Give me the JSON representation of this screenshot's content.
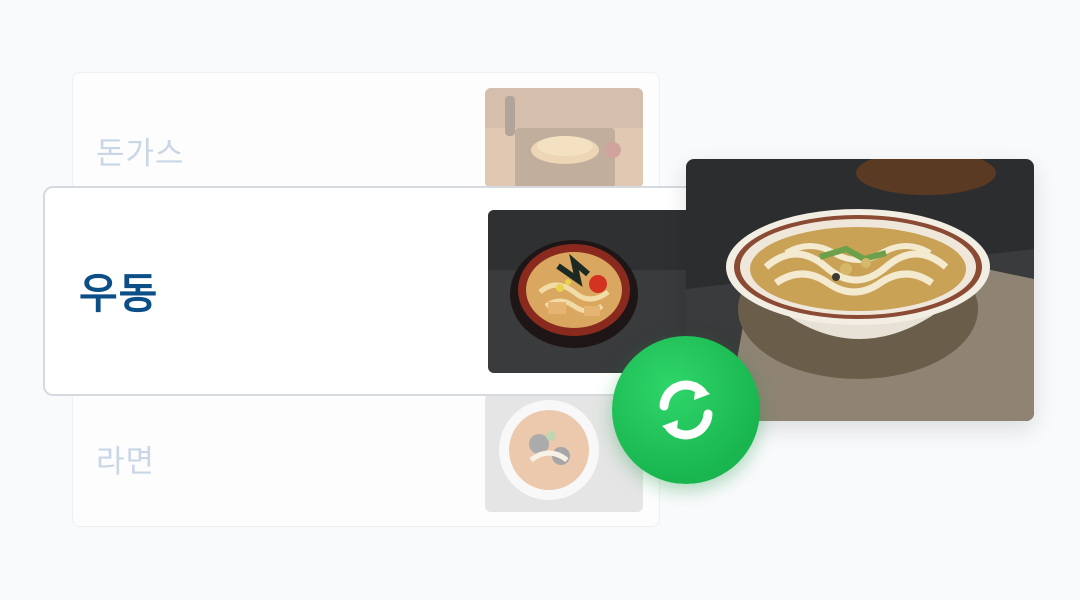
{
  "menu": {
    "items": [
      {
        "label": "돈가스",
        "state": "faded",
        "image": "tonkatsu-photo"
      },
      {
        "label": "우동",
        "state": "selected",
        "image": "udon-photo"
      },
      {
        "label": "라면",
        "state": "faded",
        "image": "ramen-photo"
      }
    ]
  },
  "preview": {
    "image": "udon-replacement-photo"
  },
  "swap": {
    "icon": "refresh-icon",
    "color": "#1fc45a"
  },
  "colors": {
    "selected_text": "#0b4f86",
    "faded_text": "#c9d6e6",
    "background": "#f9fafc"
  }
}
